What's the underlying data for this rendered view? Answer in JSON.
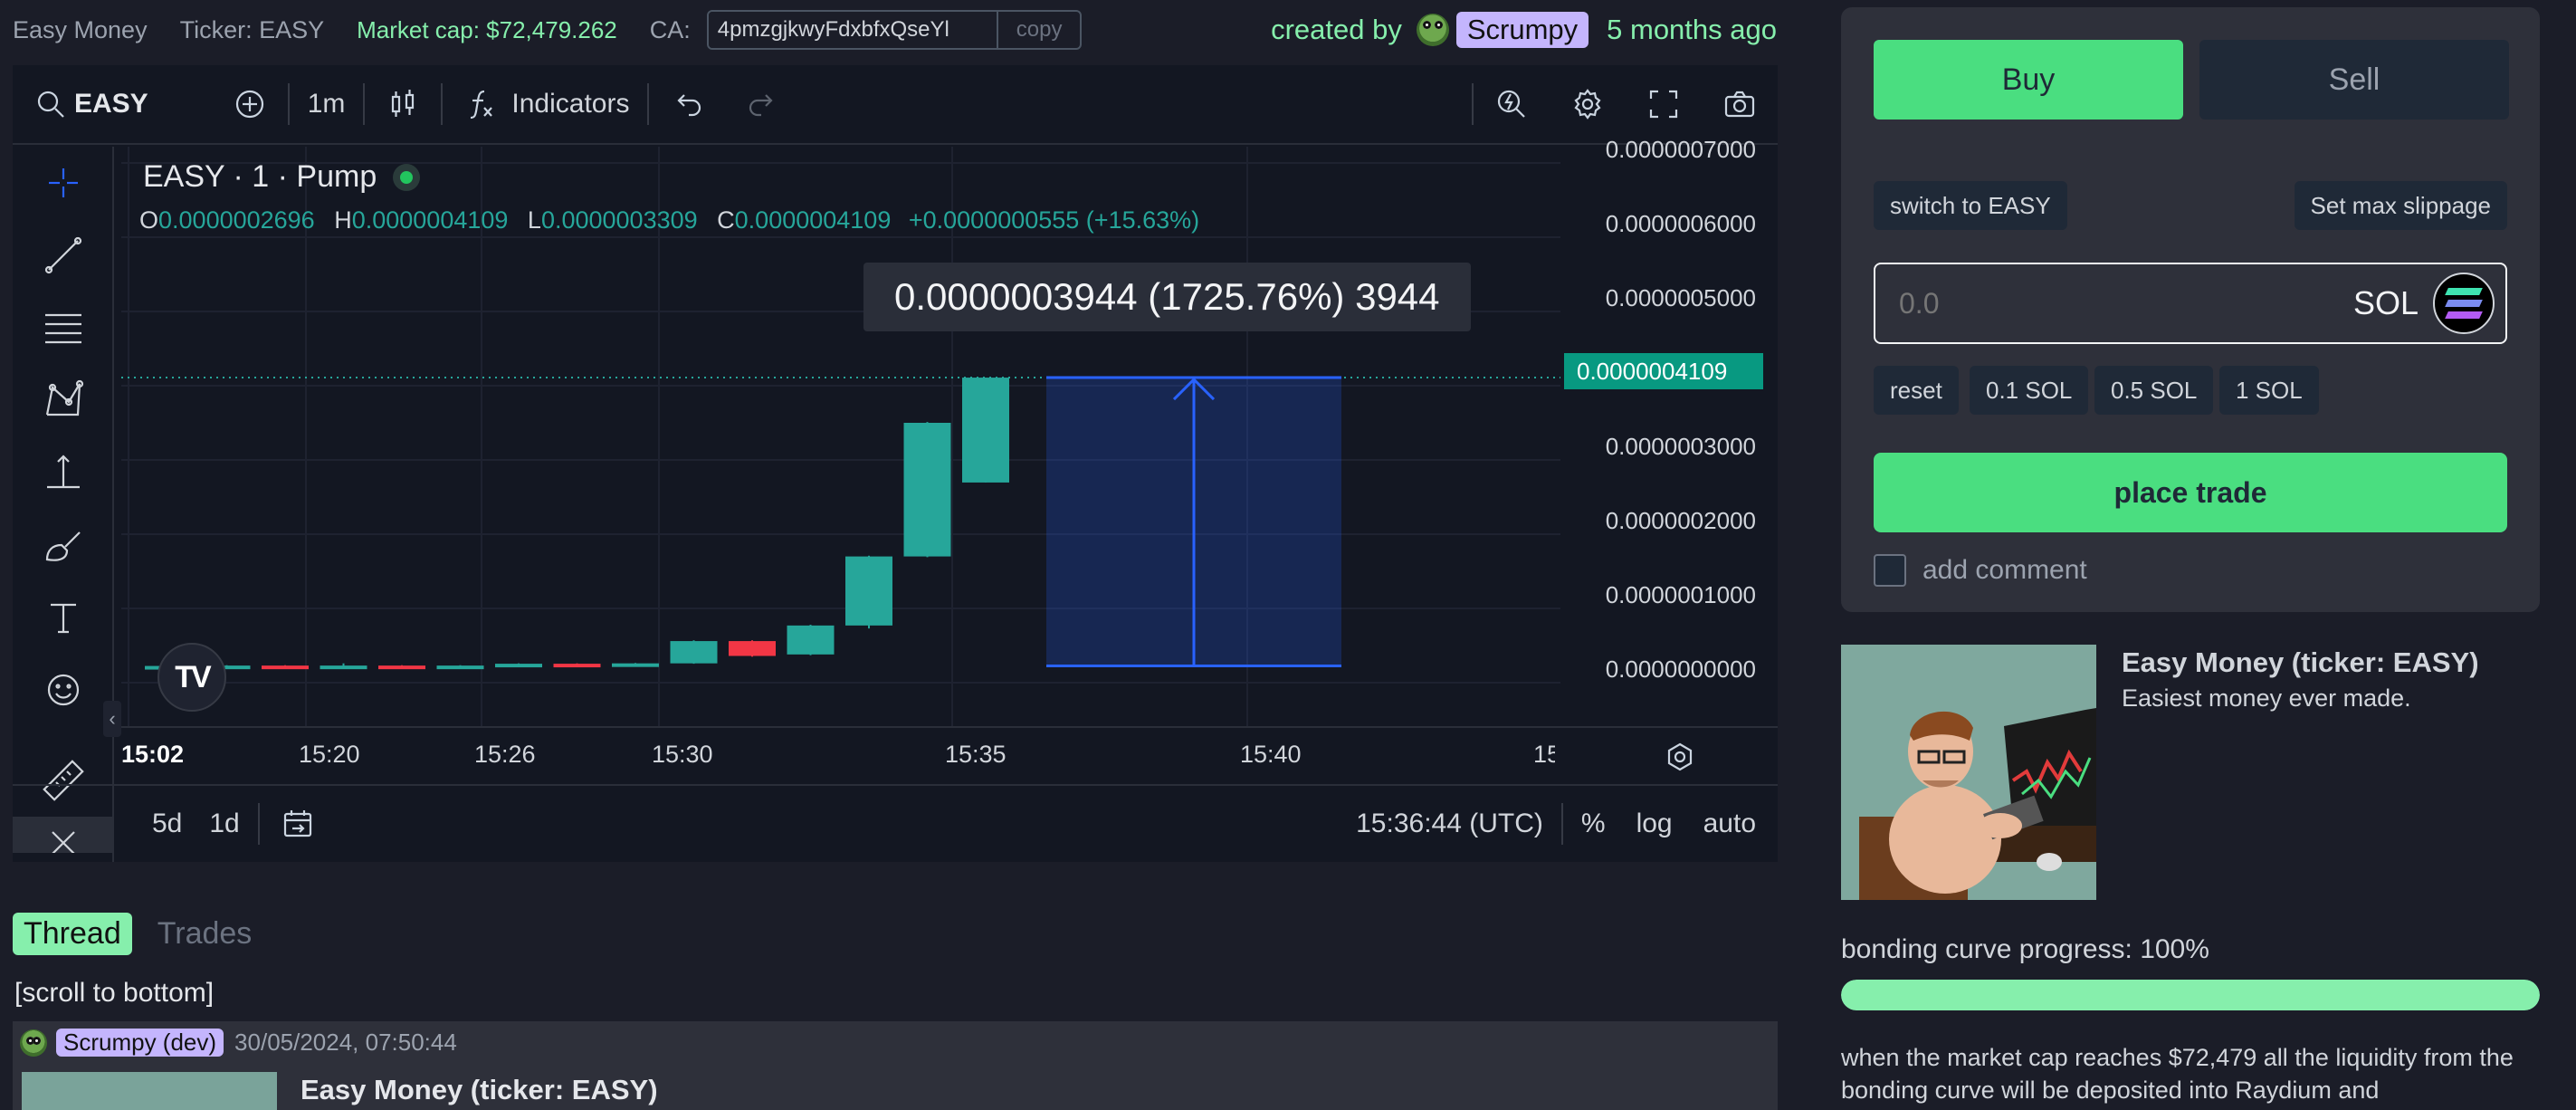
{
  "topbar": {
    "name": "Easy Money",
    "ticker": "Ticker: EASY",
    "market_cap": "Market cap: $72,479.262",
    "ca_label": "CA:",
    "ca_value": "4pmzgjkwyFdxbfxQseYl",
    "copy_label": "copy",
    "created_by": "created by",
    "creator": "Scrumpy",
    "age": "5 months ago"
  },
  "chart_toolbar": {
    "symbol": "EASY",
    "interval": "1m",
    "indicators": "Indicators"
  },
  "chart_legend": {
    "title": "EASY · 1 · Pump",
    "o_key": "O",
    "o_val": "0.0000002696",
    "h_key": "H",
    "h_val": "0.0000004109",
    "l_key": "L",
    "l_val": "0.0000003309",
    "c_key": "C",
    "c_val": "0.0000004109",
    "change": "+0.0000000555 (+15.63%)"
  },
  "tooltip": "0.0000003944 (1725.76%) 3944",
  "price_axis": {
    "labels": [
      "0.0000007000",
      "0.0000006000",
      "0.0000005000",
      "0.0000003000",
      "0.0000002000",
      "0.0000001000",
      "0.0000000000"
    ],
    "current": "0.0000004109"
  },
  "time_axis": {
    "labels": [
      "15:02",
      "15:20",
      "15:26",
      "15:30",
      "15:35",
      "15:40",
      "15"
    ]
  },
  "chart_bottom": {
    "range_5d": "5d",
    "range_1d": "1d",
    "clock": "15:36:44 (UTC)",
    "percent": "%",
    "log": "log",
    "auto": "auto"
  },
  "chart_data": {
    "type": "candlestick",
    "title": "EASY · 1 · Pump",
    "ylim": [
      0,
      7e-07
    ],
    "y_ticks": [
      0,
      1e-07,
      2e-07,
      3e-07,
      5e-07,
      6e-07,
      7e-07
    ],
    "x_tick_labels": [
      "15:02",
      "15:20",
      "15:26",
      "15:30",
      "15:35",
      "15:40",
      "15"
    ],
    "last_price": 4.109e-07,
    "candles": [
      {
        "o": 2.25e-08,
        "c": 2.25e-08,
        "h": 2.4e-08,
        "l": 2.15e-08,
        "dir": "up"
      },
      {
        "o": 2.25e-08,
        "c": 2.3e-08,
        "h": 2.35e-08,
        "l": 2.2e-08,
        "dir": "up"
      },
      {
        "o": 2.3e-08,
        "c": 2.25e-08,
        "h": 2.35e-08,
        "l": 2.2e-08,
        "dir": "down"
      },
      {
        "o": 2.25e-08,
        "c": 2.3e-08,
        "h": 2.6e-08,
        "l": 2.2e-08,
        "dir": "up"
      },
      {
        "o": 2.3e-08,
        "c": 2.2e-08,
        "h": 2.35e-08,
        "l": 2.15e-08,
        "dir": "down"
      },
      {
        "o": 2.2e-08,
        "c": 2.3e-08,
        "h": 2.35e-08,
        "l": 2.15e-08,
        "dir": "up"
      },
      {
        "o": 2.3e-08,
        "c": 2.55e-08,
        "h": 2.6e-08,
        "l": 2.25e-08,
        "dir": "up"
      },
      {
        "o": 2.55e-08,
        "c": 2.45e-08,
        "h": 2.6e-08,
        "l": 2.4e-08,
        "dir": "down"
      },
      {
        "o": 2.45e-08,
        "c": 2.6e-08,
        "h": 2.65e-08,
        "l": 2.4e-08,
        "dir": "up"
      },
      {
        "o": 2.6e-08,
        "c": 5.6e-08,
        "h": 5.7e-08,
        "l": 2.55e-08,
        "dir": "up"
      },
      {
        "o": 5.6e-08,
        "c": 3.6e-08,
        "h": 5.7e-08,
        "l": 3.5e-08,
        "dir": "down"
      },
      {
        "o": 3.8e-08,
        "c": 7.7e-08,
        "h": 7.8e-08,
        "l": 3.7e-08,
        "dir": "up"
      },
      {
        "o": 7.7e-08,
        "c": 1.7e-07,
        "h": 1.71e-07,
        "l": 7.3e-08,
        "dir": "up"
      },
      {
        "o": 1.7e-07,
        "c": 3.5e-07,
        "h": 3.51e-07,
        "l": 1.69e-07,
        "dir": "up"
      },
      {
        "o": 2.696e-07,
        "c": 4.109e-07,
        "h": 4.109e-07,
        "l": 2.696e-07,
        "dir": "up"
      }
    ],
    "measure": {
      "from": 2.25e-08,
      "to": 4.109e-07
    }
  },
  "trade_panel": {
    "buy_label": "Buy",
    "sell_label": "Sell",
    "switch_label": "switch to EASY",
    "slippage_label": "Set max slippage",
    "amount_placeholder": "0.0",
    "currency": "SOL",
    "quick": [
      "reset",
      "0.1 SOL",
      "0.5 SOL",
      "1 SOL"
    ],
    "place_label": "place trade",
    "comment_label": "add comment"
  },
  "token": {
    "title": "Easy Money (ticker: EASY)",
    "description": "Easiest money ever made."
  },
  "bonding": {
    "label": "bonding curve progress: 100%",
    "progress": 1.0,
    "info": "when the market cap reaches $72,479 all the liquidity from the bonding curve will be deposited into Raydium and"
  },
  "thread": {
    "tab_thread": "Thread",
    "tab_trades": "Trades",
    "scroll": "[scroll to bottom]",
    "post_user": "Scrumpy (dev)",
    "post_date": "30/05/2024, 07:50:44",
    "post_title": "Easy Money (ticker: EASY)"
  },
  "colors": {
    "up": "#26a69a",
    "down": "#f23645",
    "accent_green": "#4ade80",
    "measure": "#2962ff"
  }
}
